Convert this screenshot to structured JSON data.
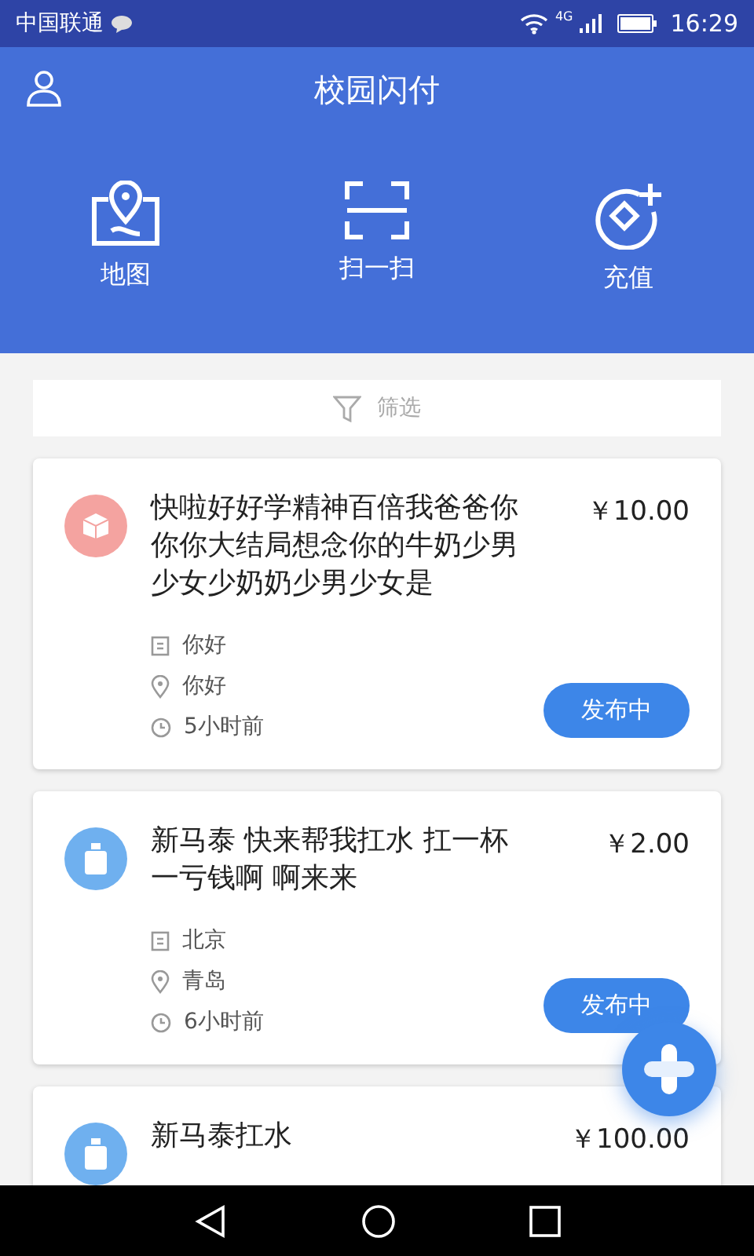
{
  "status_bar": {
    "carrier": "中国联通",
    "network": "4G",
    "time": "16:29"
  },
  "header": {
    "title": "校园闪付"
  },
  "actions": [
    {
      "kind": "map",
      "label": "地图"
    },
    {
      "kind": "scan",
      "label": "扫一扫"
    },
    {
      "kind": "recharge",
      "label": "充值"
    }
  ],
  "filter": {
    "label": "筛选"
  },
  "orders": [
    {
      "kind": "package",
      "title": "快啦好好学精神百倍我爸爸你你你大结局想念你的牛奶少男少女少奶奶少男少女是",
      "price": "￥10.00",
      "from": "你好",
      "to": "你好",
      "time": "5小时前",
      "status": "发布中"
    },
    {
      "kind": "bottle",
      "title": "新马泰  快来帮我扛水  扛一杯一亏钱啊    啊来来",
      "price": "￥2.00",
      "from": "北京",
      "to": "青岛",
      "time": "6小时前",
      "status": "发布中"
    },
    {
      "kind": "bottle",
      "title": "新马泰扛水",
      "price": "￥100.00"
    }
  ]
}
